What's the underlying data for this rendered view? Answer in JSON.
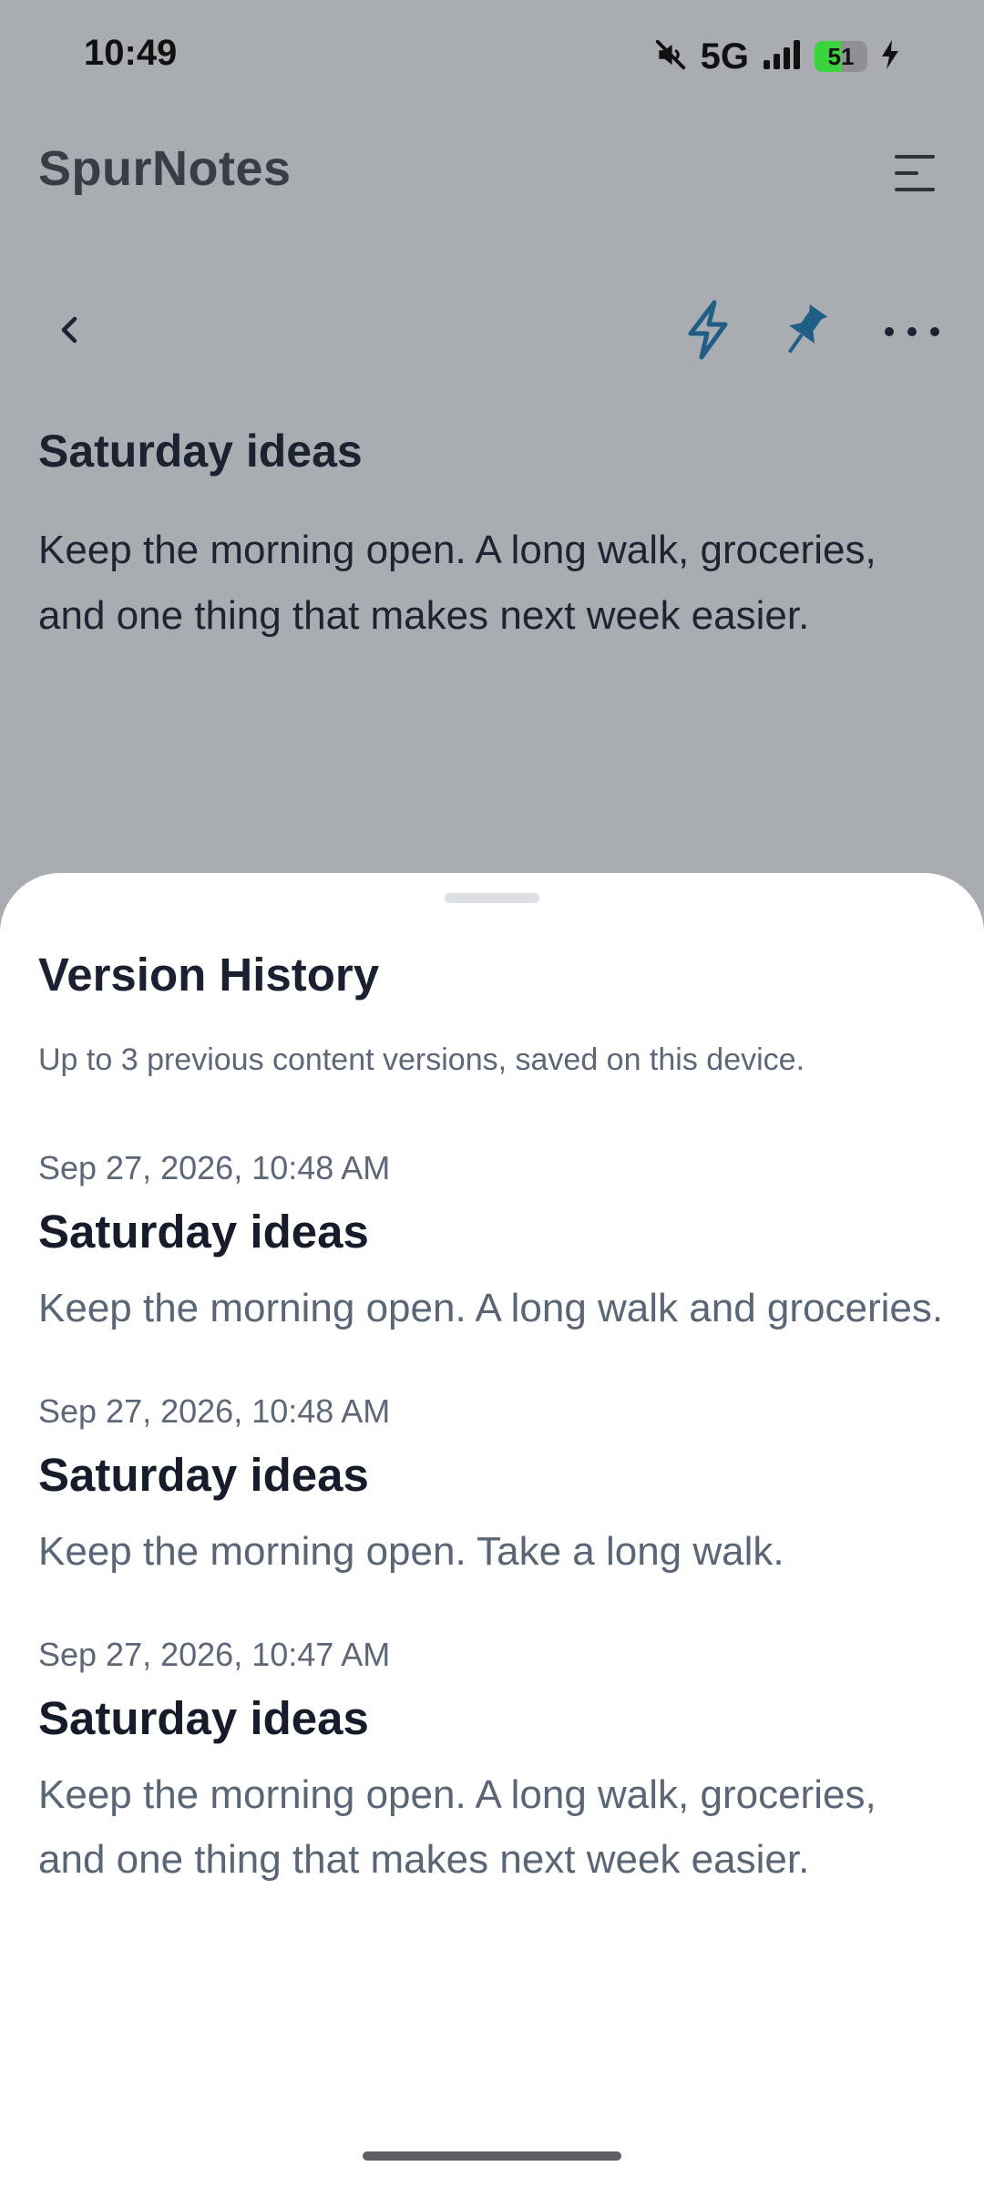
{
  "status_bar": {
    "time": "10:49",
    "network": "5G",
    "battery_level": "51",
    "battery_fill_percent": 51,
    "icons": [
      "mute-icon",
      "signal-icon",
      "battery-icon",
      "charging-icon"
    ]
  },
  "header": {
    "app_title": "SpurNotes",
    "menu_icon": "hamburger-menu-icon"
  },
  "toolbar": {
    "back_icon": "chevron-left-icon",
    "spark_icon": "lightning-icon",
    "pin_icon": "pin-icon",
    "more_icon": "more-horizontal-icon"
  },
  "note": {
    "title": "Saturday ideas",
    "body": "Keep the morning open. A long walk, groceries, and one thing that makes next week easier."
  },
  "version_history": {
    "title": "Version History",
    "subtitle": "Up to 3 previous content versions, saved on this device.",
    "versions": [
      {
        "timestamp": "Sep 27, 2026, 10:48 AM",
        "title": "Saturday ideas",
        "body": "Keep the morning open. A long walk and groceries."
      },
      {
        "timestamp": "Sep 27, 2026, 10:48 AM",
        "title": "Saturday ideas",
        "body": "Keep the morning open. Take a long walk."
      },
      {
        "timestamp": "Sep 27, 2026, 10:47 AM",
        "title": "Saturday ideas",
        "body": "Keep the morning open. A long walk, groceries, and one thing that makes next week easier."
      }
    ]
  },
  "colors": {
    "scrim_background": "#a9acb1",
    "accent_icon": "#1f5f86",
    "sheet_background": "#ffffff",
    "battery_green": "#3bd43f"
  }
}
